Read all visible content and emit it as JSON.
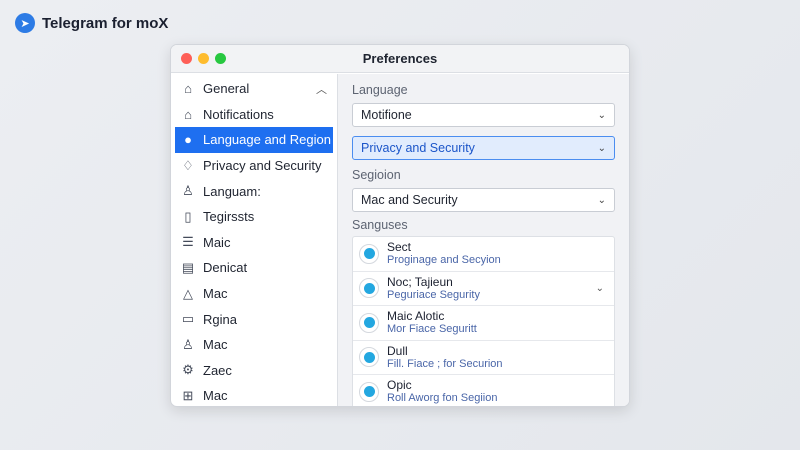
{
  "app": {
    "title": "Telegram for moX",
    "icon": "telegram-logo-icon"
  },
  "window": {
    "title": "Preferences",
    "traffic_lights": [
      "#fe5f57",
      "#febc2e",
      "#28c840"
    ]
  },
  "sidebar": {
    "items": [
      {
        "label": "General",
        "icon": "⌂",
        "expanded": true
      },
      {
        "label": "Notifications",
        "icon": "⌂"
      },
      {
        "label": "Language and Region",
        "icon": "●",
        "selected": true
      },
      {
        "label": "Privacy and Security",
        "icon": "♢"
      },
      {
        "label": "Languam:",
        "icon": "♙"
      },
      {
        "label": "Tegirssts",
        "icon": "▯"
      },
      {
        "label": "Maic",
        "icon": "☰"
      },
      {
        "label": "Denicat",
        "icon": "▤"
      },
      {
        "label": "Mac",
        "icon": "△"
      },
      {
        "label": "Rgina",
        "icon": "▭"
      },
      {
        "label": "Mac",
        "icon": "♙"
      },
      {
        "label": "Zaec",
        "icon": "⚙"
      },
      {
        "label": "Mac",
        "icon": "⊞"
      }
    ]
  },
  "main": {
    "language_label": "Language",
    "language_value": "Motifione",
    "privacy_value": "Privacy and Security",
    "region_label": "Segioion",
    "region_value": "Mac and Security",
    "list_label": "Sanguses",
    "list": [
      {
        "title": "Sect",
        "subtitle": "Proginage and Secyion"
      },
      {
        "title": "Noc; Tajieun",
        "subtitle": "Peguriace Segurity",
        "chevron": true
      },
      {
        "title": "Maic Alotic",
        "subtitle": "Mor Fiace Seguritt"
      },
      {
        "title": "Dull",
        "subtitle": "Fill. Fiace ; for Securion"
      },
      {
        "title": "Opic",
        "subtitle": "Roll Aworg fon Segiion"
      }
    ]
  },
  "colors": {
    "accent": "#1e6ff0"
  }
}
